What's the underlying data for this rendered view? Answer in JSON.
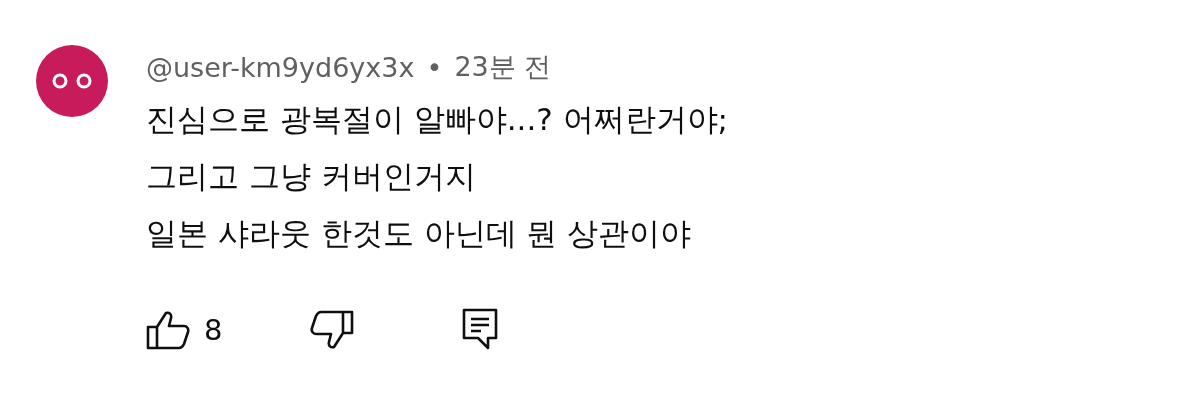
{
  "comment": {
    "author": "@user-km9yd6yx3x",
    "separator": "•",
    "time": "23분 전",
    "lines": [
      "진심으로 광복절이 알빠야...? 어쩌란거야;",
      "그리고 그냥 커버인거지",
      "일본 샤라웃 한것도 아닌데 뭔 상관이야"
    ],
    "like_count": "8"
  }
}
